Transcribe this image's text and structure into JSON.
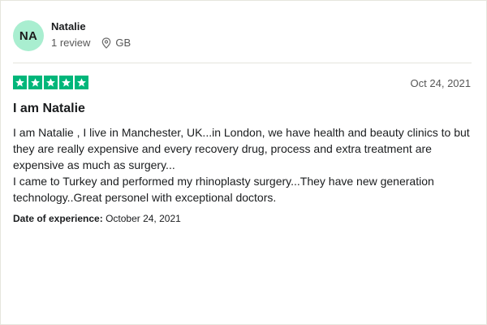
{
  "reviewer": {
    "initials": "NA",
    "name": "Natalie",
    "review_count": "1 review",
    "country": "GB",
    "avatar_color": "#a9eed0"
  },
  "rating": {
    "stars": 5,
    "max": 5,
    "star_color": "#00b67a"
  },
  "review": {
    "date": "Oct 24, 2021",
    "title": "I am Natalie",
    "paragraphs": [
      "I am Natalie , I live in Manchester, UK...in London, we have health and beauty clinics to but they are really expensive and every recovery drug, process and extra treatment are expensive as much as surgery...",
      "I came to Turkey and performed my rhinoplasty surgery...They have new generation technology..Great personel with exceptional doctors."
    ],
    "experience_label": "Date of experience:",
    "experience_date": "October 24, 2021"
  },
  "icons": {
    "location": "location-pin-icon",
    "star": "star-icon"
  }
}
